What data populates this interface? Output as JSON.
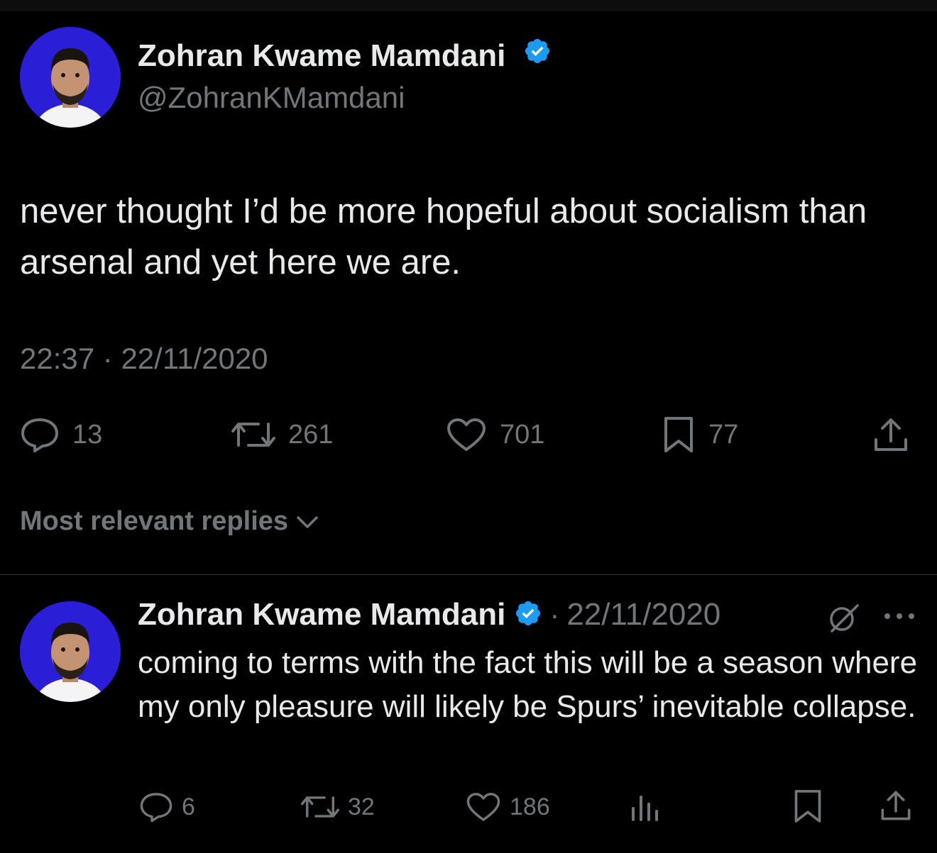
{
  "tweet": {
    "author": {
      "name": "Zohran Kwame Mamdani",
      "handle": "@ZohranKMamdani",
      "verified": true,
      "avatar_bg": "#2a1fd6"
    },
    "text": "never thought I’d be more hopeful about socialism than arsenal and yet here we are.",
    "time": "22:37",
    "separator": "·",
    "date": "22/11/2020",
    "stats": {
      "replies": "13",
      "retweets": "261",
      "likes": "701",
      "bookmarks": "77"
    }
  },
  "replies_sort": {
    "label": "Most relevant replies"
  },
  "reply": {
    "author": {
      "name": "Zohran Kwame Mamdani",
      "verified": true
    },
    "separator": "·",
    "date": "22/11/2020",
    "text": "coming to terms with the fact this will be a season where my only pleasure will likely be Spurs’ inevitable collapse.",
    "stats": {
      "replies": "6",
      "retweets": "32",
      "likes": "186"
    }
  },
  "colors": {
    "background": "#000000",
    "text": "#e7e9ea",
    "muted": "#71767b",
    "verified": "#1d9bf0",
    "divider": "#2f3336"
  },
  "icons": [
    "reply-icon",
    "retweet-icon",
    "like-icon",
    "bookmark-icon",
    "share-icon",
    "views-icon",
    "grok-icon",
    "more-icon",
    "verified-badge-icon",
    "chevron-down-icon"
  ]
}
